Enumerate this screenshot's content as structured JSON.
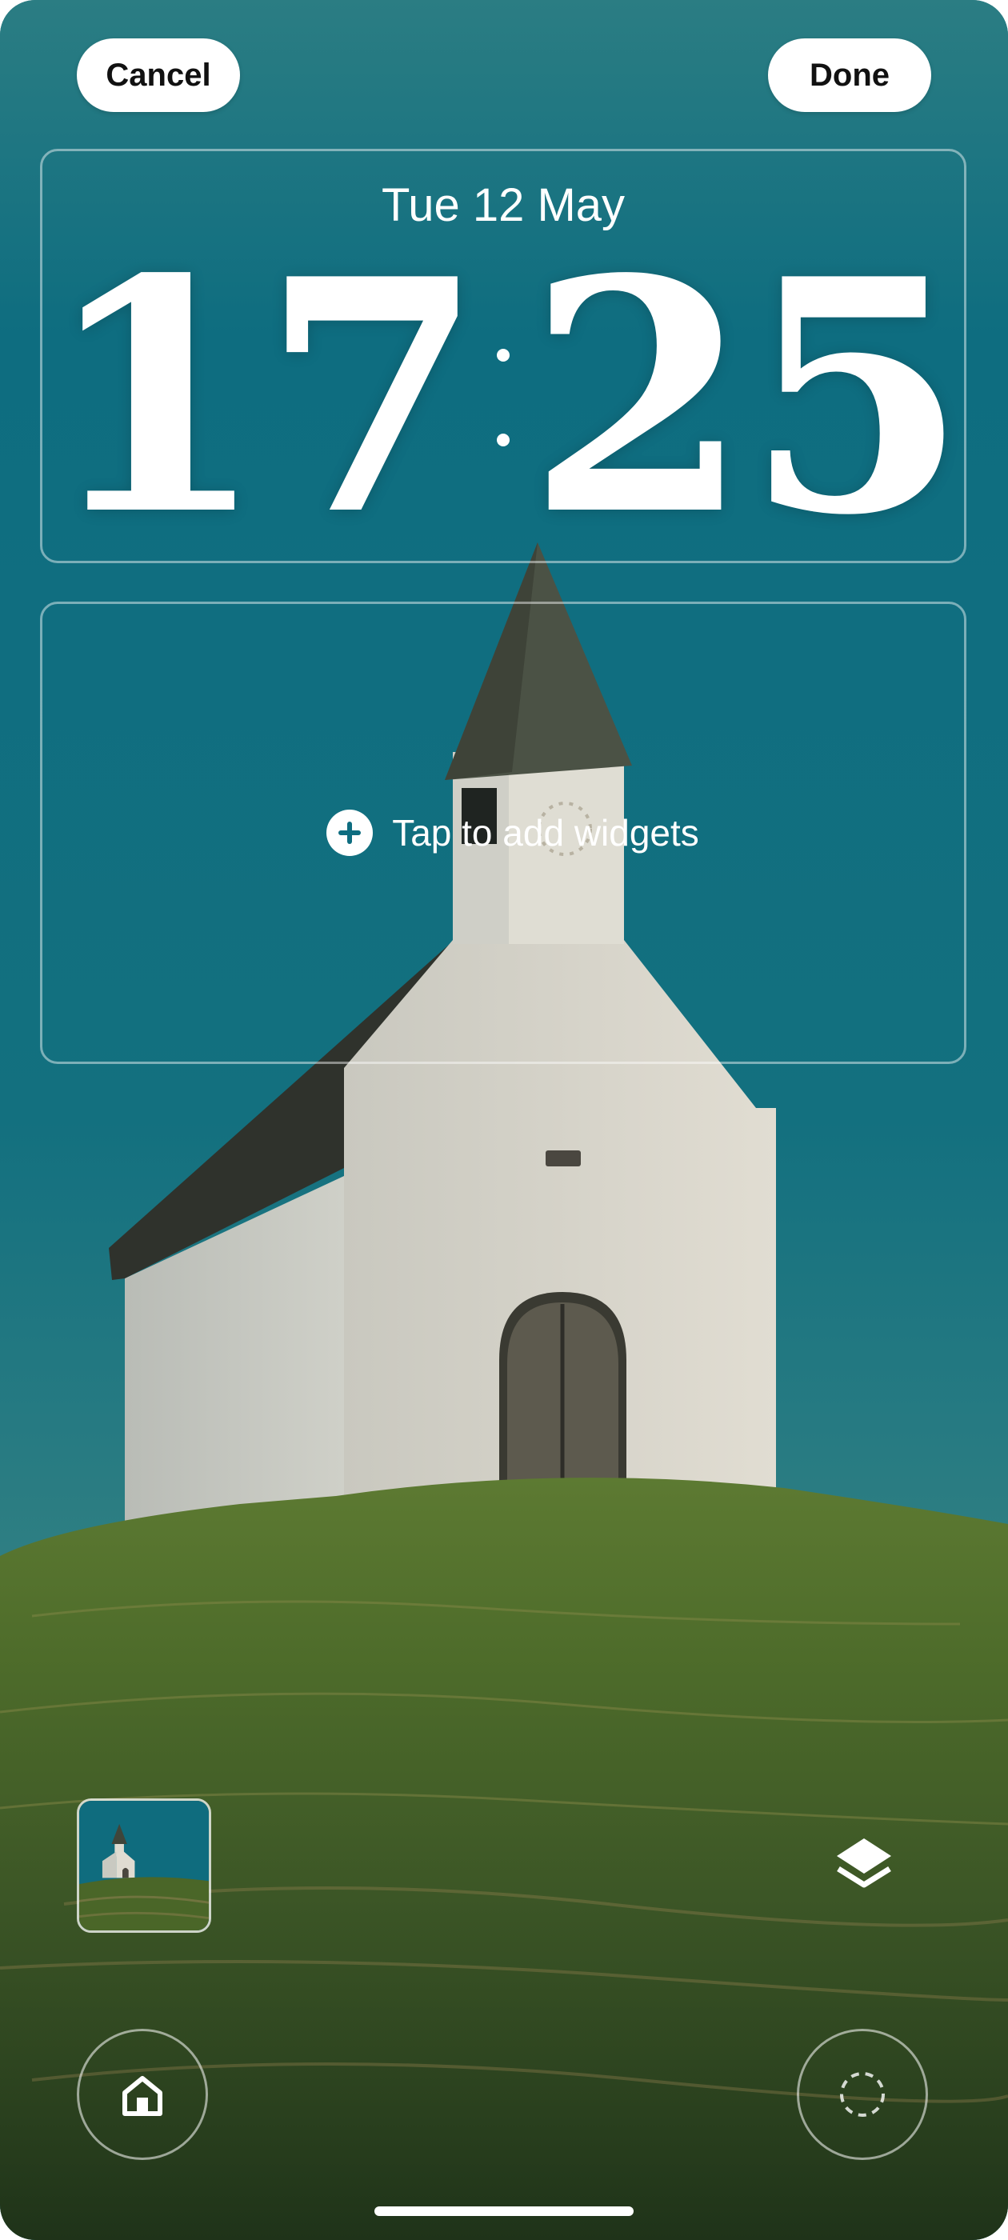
{
  "header": {
    "cancel_label": "Cancel",
    "done_label": "Done"
  },
  "lock_clock": {
    "date": "Tue 12 May",
    "hours": "17",
    "minutes": "25"
  },
  "widgets": {
    "add_label": "Tap to add widgets",
    "icon": "plus-circle-icon"
  },
  "bottom_bar": {
    "wallpaper_thumbnail": "wallpaper-thumbnail",
    "layers_icon": "layers-icon",
    "home_icon": "home-icon",
    "customize_icon": "dashed-circle-icon"
  },
  "colors": {
    "sky": "#0e6d80",
    "grass": "#3f5a2a",
    "church_wall": "#dcd8cc",
    "roof": "#3a3d34",
    "button_bg": "#ffffff"
  }
}
